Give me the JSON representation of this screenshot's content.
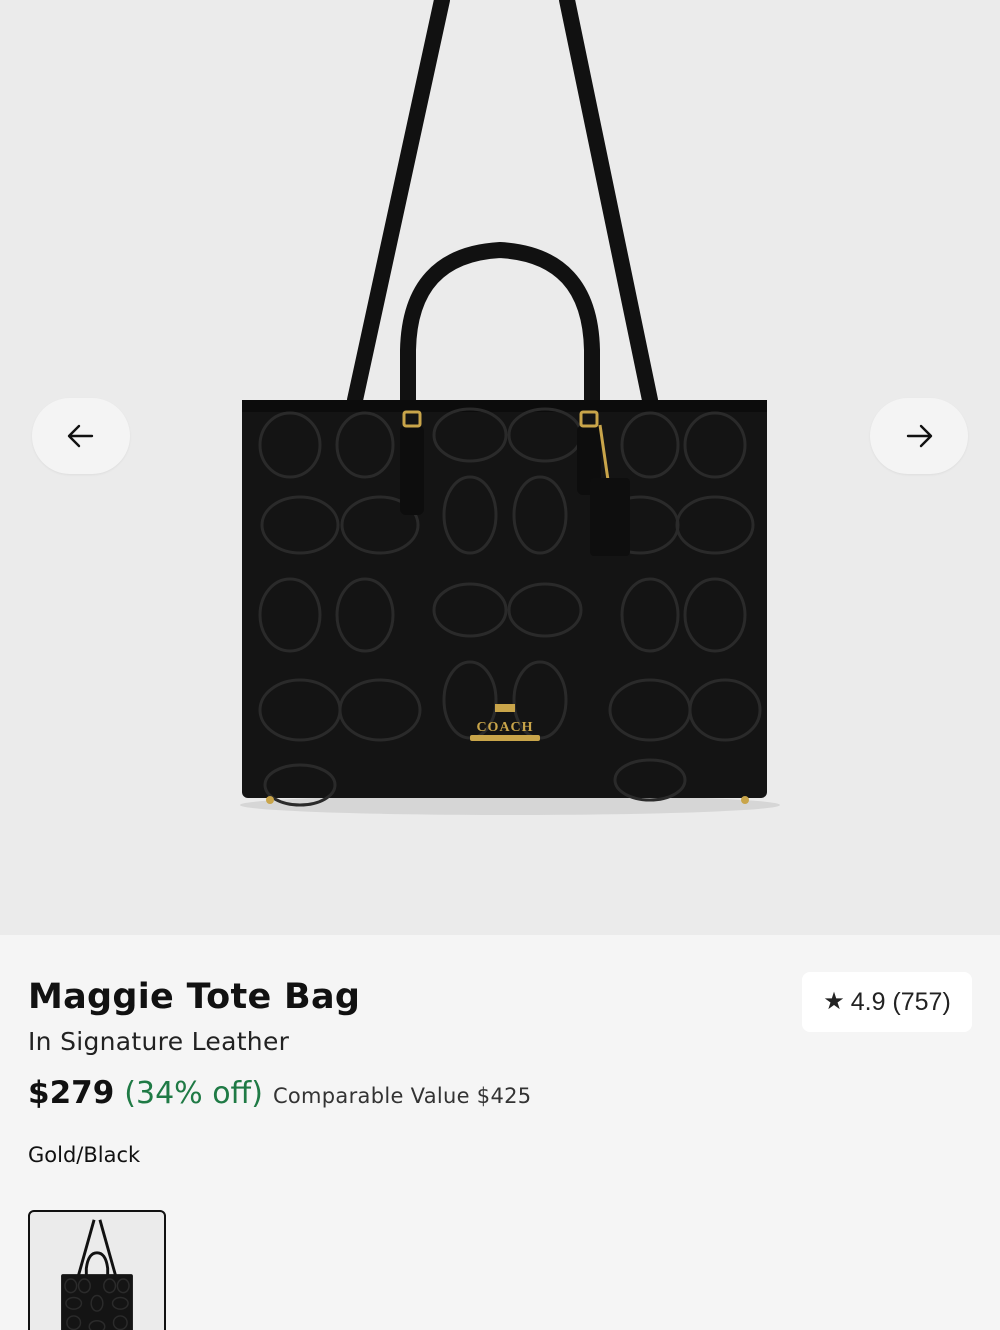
{
  "gallery": {
    "prev_icon": "arrow-left-icon",
    "next_icon": "arrow-right-icon",
    "logo_text": "COACH"
  },
  "product": {
    "name": "Maggie Tote Bag",
    "subtitle": "In Signature Leather",
    "price": "$279",
    "discount": "(34% off)",
    "comparable": "Comparable Value $425",
    "color": "Gold/Black"
  },
  "rating": {
    "icon": "star-icon",
    "text": "4.9 (757)"
  },
  "colors": {
    "bag": "#141414",
    "hardware": "#c9a54a",
    "discount": "#1f7a45",
    "background": "#ebebeb"
  }
}
